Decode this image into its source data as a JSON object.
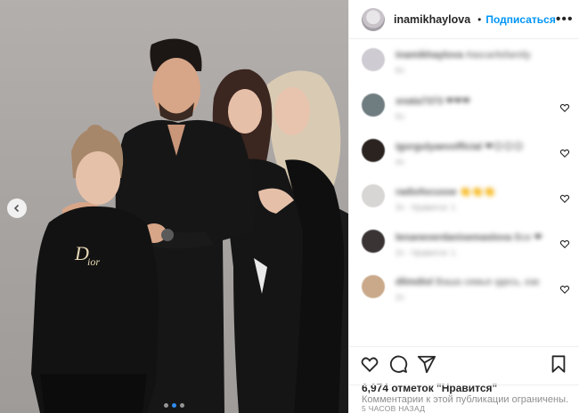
{
  "post": {
    "username": "inamikhaylova",
    "follow_label": "Подписаться",
    "separator": "•",
    "more_label": "•••",
    "likes_text": "6,974 отметок \"Нравится\"",
    "time_text": "5 ЧАСОВ НАЗАД",
    "comments_closed_text": "Комментарии к этой публикации ограничены."
  },
  "carousel": {
    "total_slides": 3,
    "active_index": 1
  },
  "comments": [
    {
      "username": "inamikhaylova",
      "text": "#ascaritsfamily",
      "meta": "6ч",
      "avatar_color": "#cfcbd2",
      "hearts": 0
    },
    {
      "username": "xnata7373",
      "text": "❤❤❤",
      "meta": "5ч",
      "avatar_color": "#6f7c80",
      "hearts": 1
    },
    {
      "username": "igorgulyaevofficial",
      "text": "❤😊😊😊",
      "meta": "4ч",
      "avatar_color": "#2a2320",
      "hearts": 1
    },
    {
      "username": "radiofocusse",
      "text": "👏👏👏",
      "meta": "3ч · Нравится: 1",
      "avatar_color": "#d8d6d4",
      "hearts": 1
    },
    {
      "username": "lenaneverdanisemaslova",
      "text": "Все ❤",
      "meta": "2ч · Нравится: 1",
      "avatar_color": "#3a3435",
      "hearts": 1
    },
    {
      "username": "dlimdiol",
      "text": "Ваша семья здесь, как",
      "meta": "2ч",
      "avatar_color": "#c9a98a",
      "hearts": 1
    }
  ],
  "colors": {
    "accent": "#0095f6",
    "verified": "#3897f0",
    "heart_red": "#ed4956"
  }
}
